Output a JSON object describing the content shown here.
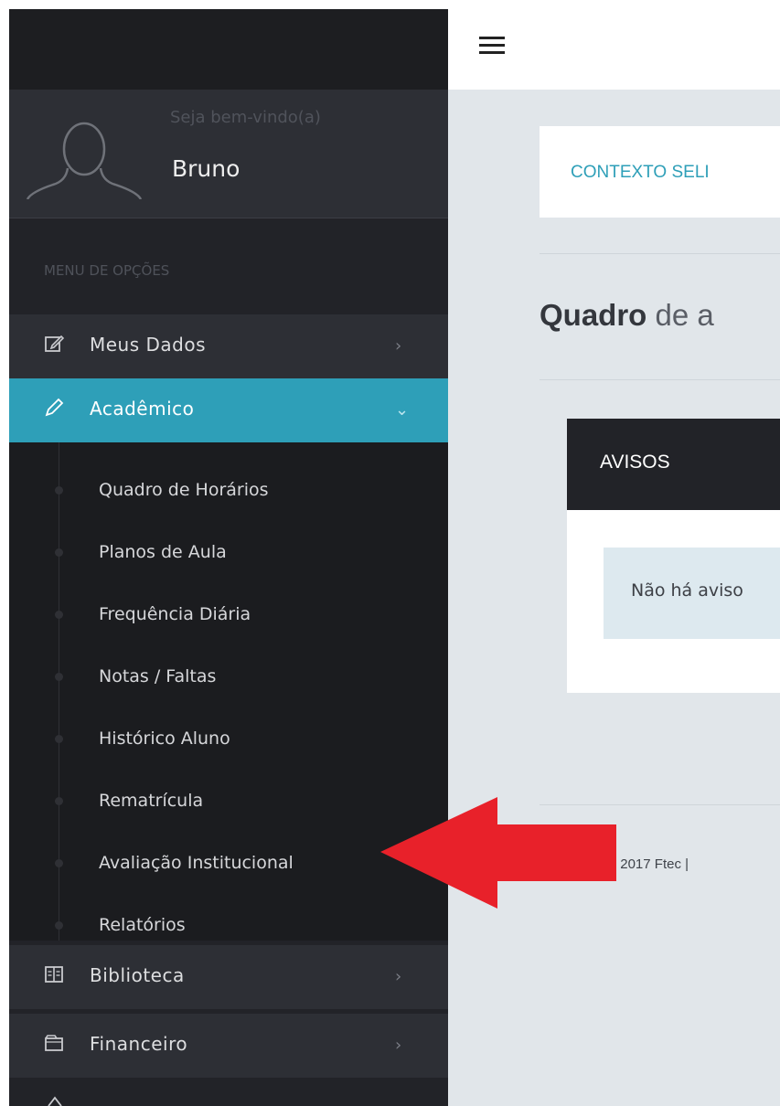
{
  "sidebar": {
    "welcome": "Seja bem-vindo(a)",
    "username": "Bruno",
    "menu_label": "MENU DE OPÇÕES",
    "items": [
      {
        "label": "Meus Dados",
        "icon": "edit-icon",
        "chevron": "›"
      },
      {
        "label": "Acadêmico",
        "icon": "pencil-icon",
        "chevron": "⌄"
      },
      {
        "label": "Biblioteca",
        "icon": "book-icon",
        "chevron": "›"
      },
      {
        "label": "Financeiro",
        "icon": "wallet-icon",
        "chevron": "›"
      }
    ],
    "submenu": [
      {
        "label": "Quadro de Horários"
      },
      {
        "label": "Planos de Aula"
      },
      {
        "label": "Frequência Diária"
      },
      {
        "label": "Notas / Faltas"
      },
      {
        "label": "Histórico Aluno"
      },
      {
        "label": "Rematrícula"
      },
      {
        "label": "Avaliação Institucional"
      },
      {
        "label": "Relatórios"
      }
    ]
  },
  "header": {
    "menu_icon": "hamburger-icon"
  },
  "main": {
    "context": "CONTEXTO SELI",
    "title_bold": "Quadro",
    "title_rest": " de a",
    "avisos_title": "AVISOS",
    "avisos_message": "Não há aviso",
    "footer": "ght © 2017 Ftec | "
  },
  "colors": {
    "accent": "#2e9fb8",
    "sidebar_bg": "#222328",
    "arrow": "#e8212a"
  }
}
